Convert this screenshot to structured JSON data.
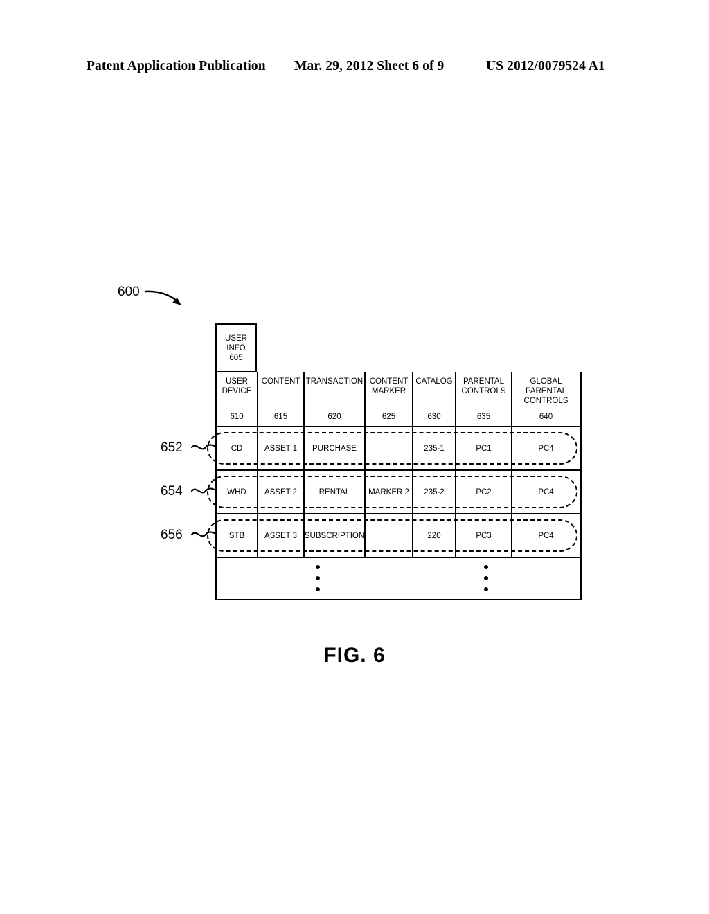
{
  "page_header": {
    "left": "Patent Application Publication",
    "center": "Mar. 29, 2012  Sheet 6 of 9",
    "right": "US 2012/0079524 A1"
  },
  "figure": {
    "caption": "FIG. 6",
    "diagram_ref": "600",
    "stub": {
      "label_line1": "USER",
      "label_line2": "INFO",
      "ref": "605"
    },
    "columns": [
      {
        "label": "USER\nDEVICE",
        "ref": "610"
      },
      {
        "label": "CONTENT",
        "ref": "615"
      },
      {
        "label": "TRANSACTION",
        "ref": "620"
      },
      {
        "label": "CONTENT\nMARKER",
        "ref": "625"
      },
      {
        "label": "CATALOG",
        "ref": "630"
      },
      {
        "label": "PARENTAL\nCONTROLS",
        "ref": "635"
      },
      {
        "label": "GLOBAL\nPARENTAL\nCONTROLS",
        "ref": "640"
      }
    ],
    "rows": [
      {
        "ref": "652",
        "cells": [
          "CD",
          "ASSET 1",
          "PURCHASE",
          "",
          "235-1",
          "PC1",
          "PC4"
        ]
      },
      {
        "ref": "654",
        "cells": [
          "WHD",
          "ASSET 2",
          "RENTAL",
          "MARKER 2",
          "235-2",
          "PC2",
          "PC4"
        ]
      },
      {
        "ref": "656",
        "cells": [
          "STB",
          "ASSET 3",
          "SUBSCRIPTION",
          "",
          "220",
          "PC3",
          "PC4"
        ]
      }
    ],
    "continuation": {
      "symbol": "vertical-ellipsis",
      "count": 2
    }
  },
  "colors": {
    "ink": "#000000",
    "paper": "#ffffff"
  }
}
